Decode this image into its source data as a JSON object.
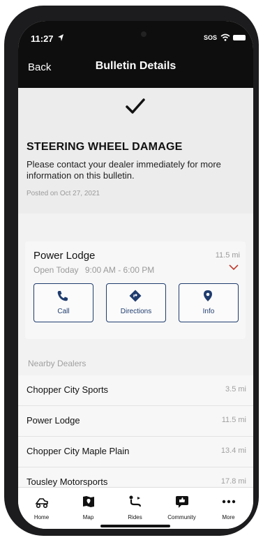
{
  "status_bar": {
    "time": "11:27",
    "carrier": "SOS"
  },
  "nav": {
    "back_label": "Back",
    "title": "Bulletin Details"
  },
  "bulletin": {
    "title": "STEERING WHEEL DAMAGE",
    "body": "Please contact your dealer immediately for more information on this bulletin.",
    "posted": "Posted on Oct 27, 2021"
  },
  "dealer": {
    "name": "Power Lodge",
    "distance": "11.5 mi",
    "status": "Open Today",
    "hours": "9:00 AM - 6:00 PM",
    "actions": {
      "call": "Call",
      "directions": "Directions",
      "info": "Info"
    }
  },
  "nearby": {
    "heading": "Nearby Dealers",
    "items": [
      {
        "name": "Chopper City Sports",
        "distance": "3.5 mi"
      },
      {
        "name": "Power Lodge",
        "distance": "11.5 mi"
      },
      {
        "name": "Chopper City Maple Plain",
        "distance": "13.4 mi"
      },
      {
        "name": "Tousley Motorsports",
        "distance": "17.8 mi"
      }
    ]
  },
  "tabs": [
    {
      "label": "Home",
      "icon": "snowmobile-icon"
    },
    {
      "label": "Map",
      "icon": "map-icon"
    },
    {
      "label": "Rides",
      "icon": "rides-icon"
    },
    {
      "label": "Community",
      "icon": "community-icon"
    },
    {
      "label": "More",
      "icon": "more-icon"
    }
  ],
  "colors": {
    "accent": "#1f3c6e",
    "header": "#0e0e0e"
  }
}
